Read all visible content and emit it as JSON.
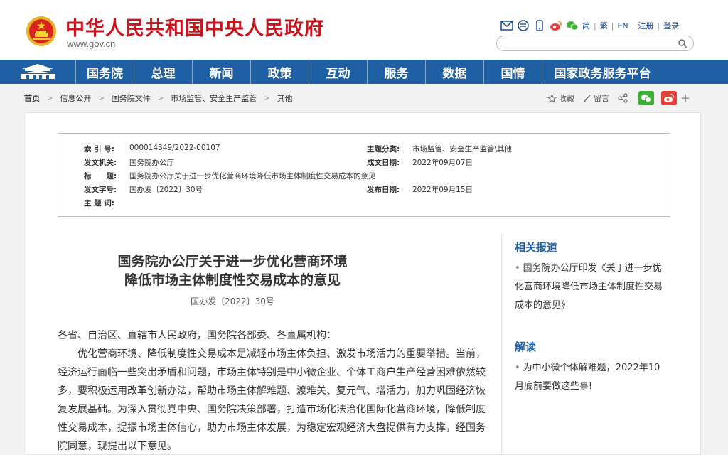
{
  "header": {
    "site_title": "中华人民共和国中央人民政府",
    "site_domain": "www.gov.cn",
    "links": [
      "简",
      "繁",
      "EN",
      "注册",
      "登录"
    ],
    "icons": [
      "mail-icon",
      "app-icon",
      "mobile-icon",
      "weibo-icon",
      "wechat-icon"
    ],
    "search_placeholder": ""
  },
  "nav": {
    "items": [
      "国务院",
      "总理",
      "新闻",
      "政策",
      "互动",
      "服务",
      "数据",
      "国情",
      "国家政务服务平台"
    ]
  },
  "breadcrumb": [
    "首页",
    "信息公开",
    "国务院文件",
    "市场监管、安全生产监管",
    "其他"
  ],
  "actions": {
    "favorite": "收藏",
    "comment": "留言"
  },
  "meta": {
    "index_label": "索 引 号:",
    "index_value": "000014349/2022-00107",
    "topic_label": "主题分类:",
    "topic_value": "市场监管、安全生产监管\\其他",
    "issuer_label": "发文机关:",
    "issuer_value": "国务院办公厅",
    "written_label": "成文日期:",
    "written_value": "2022年09月07日",
    "title_label": "标　　题:",
    "title_value": "国务院办公厅关于进一步优化营商环境降低市场主体制度性交易成本的意见",
    "docno_label": "发文字号:",
    "docno_value": "国办发〔2022〕30号",
    "published_label": "发布日期:",
    "published_value": "2022年09月15日",
    "keywords_label": "主 题 词:",
    "keywords_value": ""
  },
  "document": {
    "title_line1": "国务院办公厅关于进一步优化营商环境",
    "title_line2": "降低市场主体制度性交易成本的意见",
    "doc_number": "国办发〔2022〕30号",
    "salutation": "各省、自治区、直辖市人民政府，国务院各部委、各直属机构：",
    "paragraph1": "优化营商环境、降低制度性交易成本是减轻市场主体负担、激发市场活力的重要举措。当前，经济运行面临一些突出矛盾和问题，市场主体特别是中小微企业、个体工商户生产经营困难依然较多，要积极运用改革创新办法，帮助市场主体解难题、渡难关、复元气、增活力，加力巩固经济恢复发展基础。为深入贯彻党中央、国务院决策部署，打造市场化法治化国际化营商环境，降低制度性交易成本，提振市场主体信心，助力市场主体发展，为稳定宏观经济大盘提供有力支撑，经国务院同意，现提出以下意见。"
  },
  "sidebar": {
    "related_heading": "相关报道",
    "related_link": "国务院办公厅印发《关于进一步优化营商环境降低市场主体制度性交易成本的意见》",
    "interpret_heading": "解读",
    "interpret_link": "为中小微个体解难题，2022年10月底前要做这些事!"
  },
  "colors": {
    "nav_blue": "#1f5fa3",
    "brand_red": "#c8151d"
  }
}
